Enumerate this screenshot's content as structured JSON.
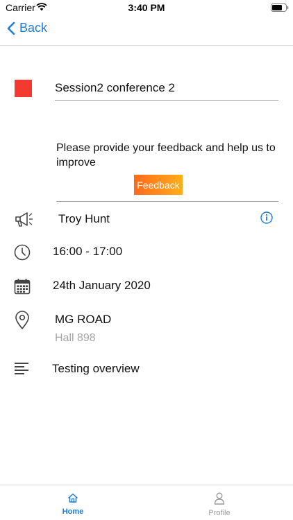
{
  "status_bar": {
    "carrier": "Carrier",
    "time": "3:40 PM"
  },
  "nav": {
    "back_label": "Back"
  },
  "session": {
    "title": "Session2 conference 2",
    "color": "#f43a30"
  },
  "feedback": {
    "prompt": "Please provide your feedback and help us to improve",
    "button_label": "Feedback"
  },
  "details": {
    "speaker": "Troy Hunt",
    "time": "16:00 - 17:00",
    "date": "24th January 2020",
    "venue": "MG ROAD",
    "hall": "Hall 898",
    "description": "Testing overview"
  },
  "tabs": [
    {
      "label": "Home",
      "icon": "home-icon",
      "active": true
    },
    {
      "label": "Profile",
      "icon": "profile-icon",
      "active": false
    }
  ],
  "colors": {
    "accent": "#1d7ce0",
    "icon": "#444444",
    "inactive": "#9a9a9a"
  }
}
